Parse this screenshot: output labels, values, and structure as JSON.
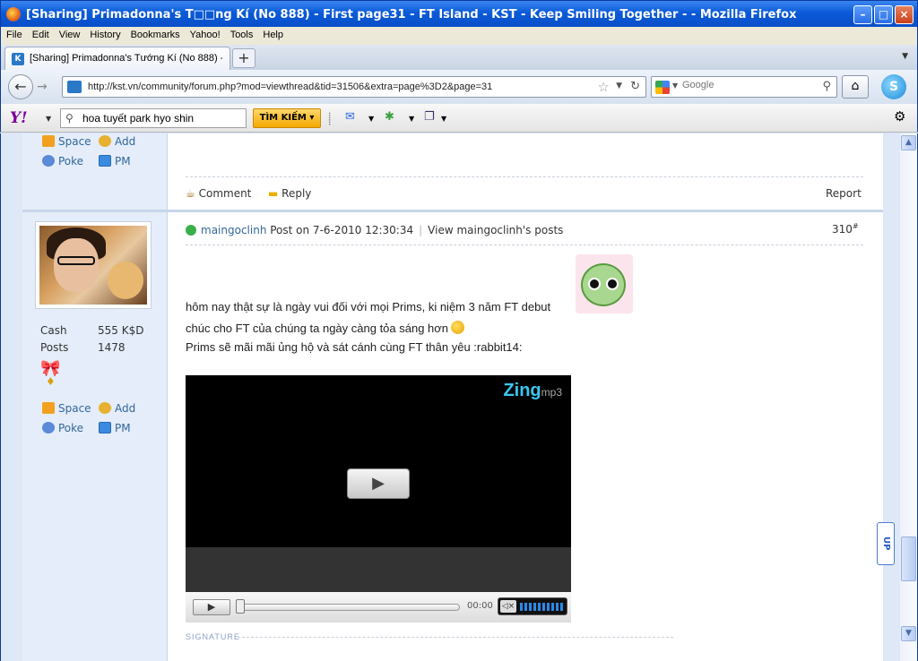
{
  "window": {
    "title": "[Sharing] Primadonna's T□□ng Kí (No 888) - First page31 - FT Island - KST - Keep Smiling Together - - Mozilla Firefox"
  },
  "menu": [
    "File",
    "Edit",
    "View",
    "History",
    "Bookmarks",
    "Yahoo!",
    "Tools",
    "Help"
  ],
  "tab": {
    "label": "[Sharing] Primadonna's Tướng Kí (No 888) - ..."
  },
  "nav": {
    "url": "http://kst.vn/community/forum.php?mod=viewthread&tid=31506&extra=page%3D2&page=31",
    "search_placeholder": "Google"
  },
  "yahoo": {
    "logo": "Y!",
    "search_value": "hoa tuyết park hyo shin",
    "search_button": "TÌM KIẾM"
  },
  "prev_post": {
    "links": {
      "space": "Space",
      "add": "Add",
      "poke": "Poke",
      "pm": "PM"
    },
    "actions": {
      "comment": "Comment",
      "reply": "Reply",
      "report": "Report"
    }
  },
  "post": {
    "author": "maingoclinh",
    "posted": "Post on 7-6-2010 12:30:34",
    "view_posts": "View maingoclinh's posts",
    "floor": "310",
    "floor_mark": "#",
    "stats": [
      {
        "label": "Cash",
        "value": "555 K$D"
      },
      {
        "label": "Posts",
        "value": "1478"
      }
    ],
    "links": {
      "space": "Space",
      "add": "Add",
      "poke": "Poke",
      "pm": "PM"
    },
    "lines": [
      "hôm nay thật sự là ngày vui đối với mọi Prims, ki niệm 3 năm FT debut",
      "chúc cho FT của chúng ta ngày càng tỏa sáng hơn",
      "Prims sẽ mãi mãi ủng hộ và sát cánh cùng FT thân yêu :rabbit14:"
    ],
    "player": {
      "brand": "Zing",
      "brand_suffix": "mp3",
      "time": "00:00",
      "progress": 0
    },
    "signature_label": "SIGNATURE"
  },
  "up_button": "UP"
}
